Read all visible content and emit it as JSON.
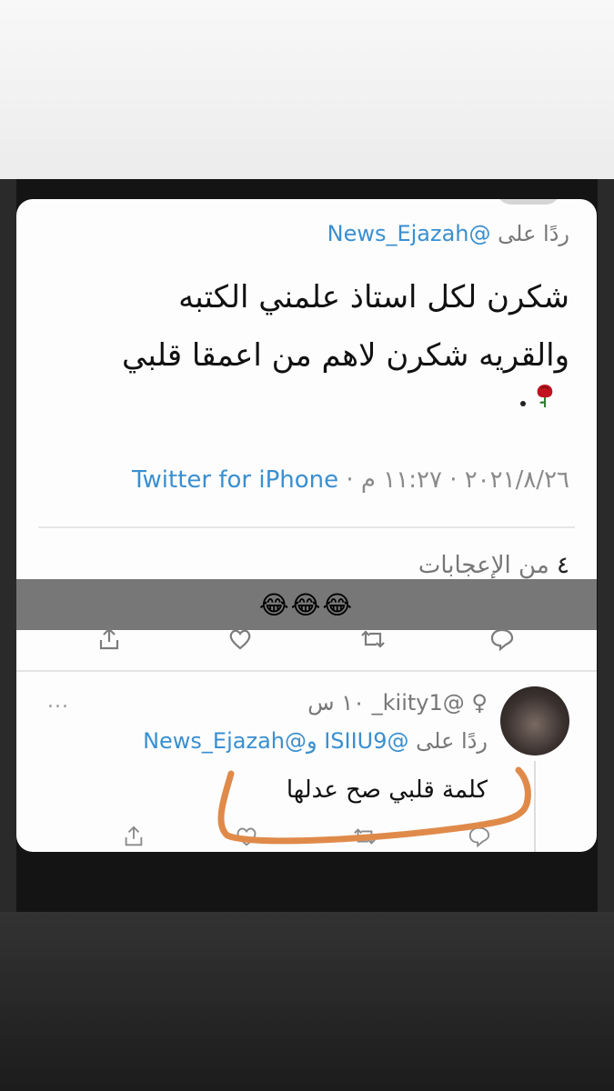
{
  "tweet": {
    "reply_prefix": "ردًا على",
    "reply_handle": "@News_Ejazah",
    "text_line1": "شكرن لكل استاذ علمني الكتبه",
    "text_line2": "والقريه شكرن لاهم من اعمقا قلبي",
    "date": "٢٠٢١/٨/٢٦",
    "time": "١١:٢٧ م",
    "separator": "·",
    "client": "Twitter for iPhone",
    "likes_count": "٤",
    "likes_label": "من الإعجابات",
    "rose_icon": "rose-emoji"
  },
  "overlay": {
    "emojis": "😂😂😂"
  },
  "reply": {
    "gender_symbol": "♀",
    "handle": "@kiity1_",
    "time": "١٠ س",
    "more": "...",
    "reply_prefix": "ردًا على",
    "reply_handles": "@ISIIU9 و@News_Ejazah",
    "text": "كلمة قلبي صح عدلها"
  },
  "colors": {
    "link": "#3a8fd0",
    "scribble": "#e08a4a",
    "overlay": "#5f5f5f"
  }
}
